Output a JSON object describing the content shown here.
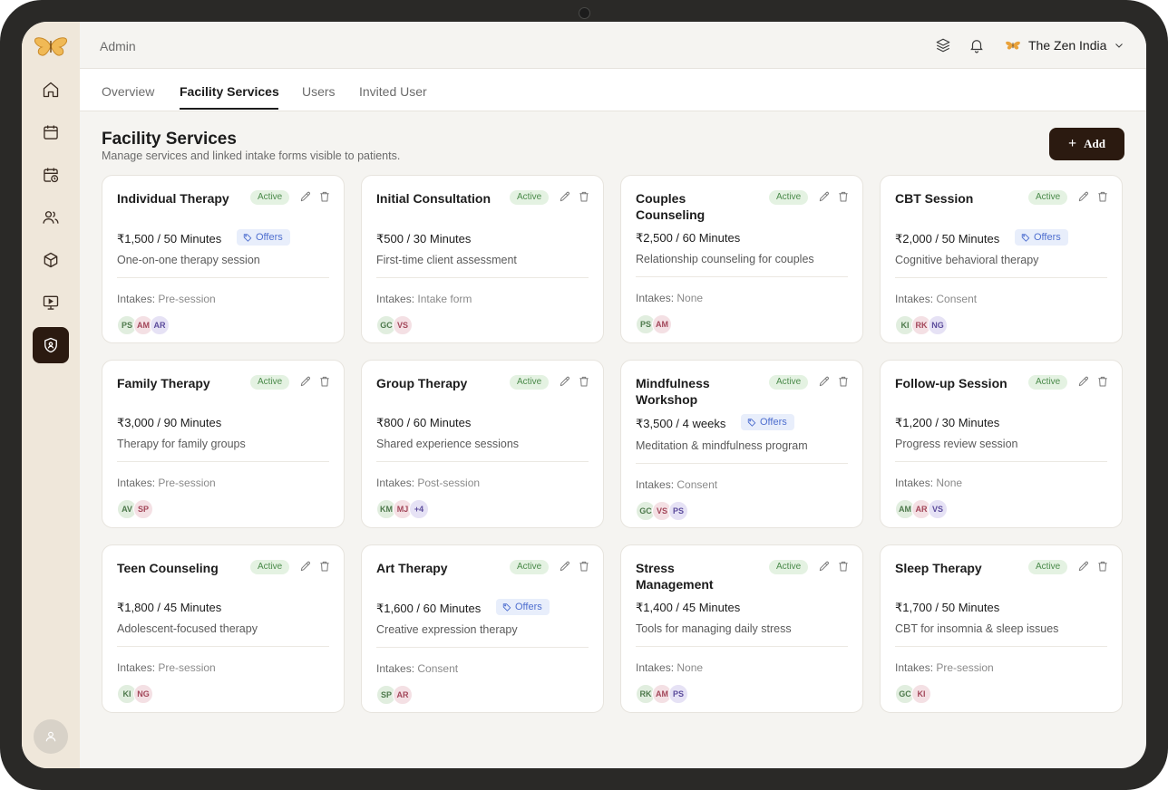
{
  "header": {
    "section": "Admin",
    "org_name": "The Zen India"
  },
  "tabs": [
    {
      "label": "Overview",
      "active": false
    },
    {
      "label": "Facility Services",
      "active": true
    },
    {
      "label": "Users",
      "active": false
    },
    {
      "label": "Invited User",
      "active": false
    }
  ],
  "page": {
    "title": "Facility Services",
    "subtitle": "Manage services and linked intake forms visible to patients.",
    "add_label": "Add"
  },
  "intakes_label": "Intakes:",
  "offers_label": "Offers",
  "sidebar": {
    "items": [
      {
        "icon": "home-icon"
      },
      {
        "icon": "calendar-icon"
      },
      {
        "icon": "calendar-clock-icon"
      },
      {
        "icon": "users-icon"
      },
      {
        "icon": "cube-icon"
      },
      {
        "icon": "presentation-icon"
      },
      {
        "icon": "shield-icon",
        "active": true
      }
    ]
  },
  "services": [
    {
      "name": "Individual Therapy",
      "status": "Active",
      "price": "₹1,500 / 50 Minutes",
      "offers": true,
      "description": "One-on-one therapy session",
      "intakes": "Pre-session",
      "avatars": [
        {
          "i": "PS",
          "c": "g"
        },
        {
          "i": "AM",
          "c": "p"
        },
        {
          "i": "AR",
          "c": "v"
        }
      ]
    },
    {
      "name": "Initial Consultation",
      "status": "Active",
      "price": "₹500 / 30 Minutes",
      "offers": false,
      "description": "First-time client assessment",
      "intakes": "Intake form",
      "avatars": [
        {
          "i": "GC",
          "c": "g"
        },
        {
          "i": "VS",
          "c": "p"
        }
      ]
    },
    {
      "name": "Couples Counseling",
      "status": "Active",
      "price": "₹2,500 / 60 Minutes",
      "offers": false,
      "description": "Relationship counseling for couples",
      "intakes": "None",
      "avatars": [
        {
          "i": "PS",
          "c": "g"
        },
        {
          "i": "AM",
          "c": "p"
        }
      ]
    },
    {
      "name": "CBT Session",
      "status": "Active",
      "price": "₹2,000 / 50 Minutes",
      "offers": true,
      "description": "Cognitive behavioral therapy",
      "intakes": "Consent",
      "avatars": [
        {
          "i": "KI",
          "c": "g"
        },
        {
          "i": "RK",
          "c": "p"
        },
        {
          "i": "NG",
          "c": "v"
        }
      ]
    },
    {
      "name": "Family Therapy",
      "status": "Active",
      "price": "₹3,000 / 90 Minutes",
      "offers": false,
      "description": "Therapy for family groups",
      "intakes": "Pre-session",
      "avatars": [
        {
          "i": "AV",
          "c": "g"
        },
        {
          "i": "SP",
          "c": "p"
        }
      ]
    },
    {
      "name": "Group Therapy",
      "status": "Active",
      "price": "₹800 / 60 Minutes",
      "offers": false,
      "description": "Shared experience sessions",
      "intakes": "Post-session",
      "avatars": [
        {
          "i": "KM",
          "c": "g"
        },
        {
          "i": "MJ",
          "c": "p"
        },
        {
          "i": "+4",
          "c": "v"
        }
      ]
    },
    {
      "name": "Mindfulness Workshop",
      "status": "Active",
      "price": "₹3,500 / 4 weeks",
      "offers": true,
      "description": "Meditation & mindfulness program",
      "intakes": "Consent",
      "avatars": [
        {
          "i": "GC",
          "c": "g"
        },
        {
          "i": "VS",
          "c": "p"
        },
        {
          "i": "PS",
          "c": "v"
        }
      ]
    },
    {
      "name": "Follow-up Session",
      "status": "Active",
      "price": "₹1,200 / 30 Minutes",
      "offers": false,
      "description": "Progress review session",
      "intakes": "None",
      "avatars": [
        {
          "i": "AM",
          "c": "g"
        },
        {
          "i": "AR",
          "c": "p"
        },
        {
          "i": "VS",
          "c": "v"
        }
      ]
    },
    {
      "name": "Teen Counseling",
      "status": "Active",
      "price": "₹1,800 / 45 Minutes",
      "offers": false,
      "description": "Adolescent-focused therapy",
      "intakes": "Pre-session",
      "avatars": [
        {
          "i": "KI",
          "c": "g"
        },
        {
          "i": "NG",
          "c": "p"
        }
      ]
    },
    {
      "name": "Art Therapy",
      "status": "Active",
      "price": "₹1,600 / 60 Minutes",
      "offers": true,
      "description": "Creative expression therapy",
      "intakes": "Consent",
      "avatars": [
        {
          "i": "SP",
          "c": "g"
        },
        {
          "i": "AR",
          "c": "p"
        }
      ]
    },
    {
      "name": "Stress Management",
      "status": "Active",
      "price": "₹1,400 / 45 Minutes",
      "offers": false,
      "description": "Tools for managing daily stress",
      "intakes": "None",
      "avatars": [
        {
          "i": "RK",
          "c": "g"
        },
        {
          "i": "AM",
          "c": "p"
        },
        {
          "i": "PS",
          "c": "v"
        }
      ]
    },
    {
      "name": "Sleep Therapy",
      "status": "Active",
      "price": "₹1,700 / 50 Minutes",
      "offers": false,
      "description": "CBT for insomnia & sleep issues",
      "intakes": "Pre-session",
      "avatars": [
        {
          "i": "GC",
          "c": "g"
        },
        {
          "i": "KI",
          "c": "p"
        }
      ]
    }
  ]
}
